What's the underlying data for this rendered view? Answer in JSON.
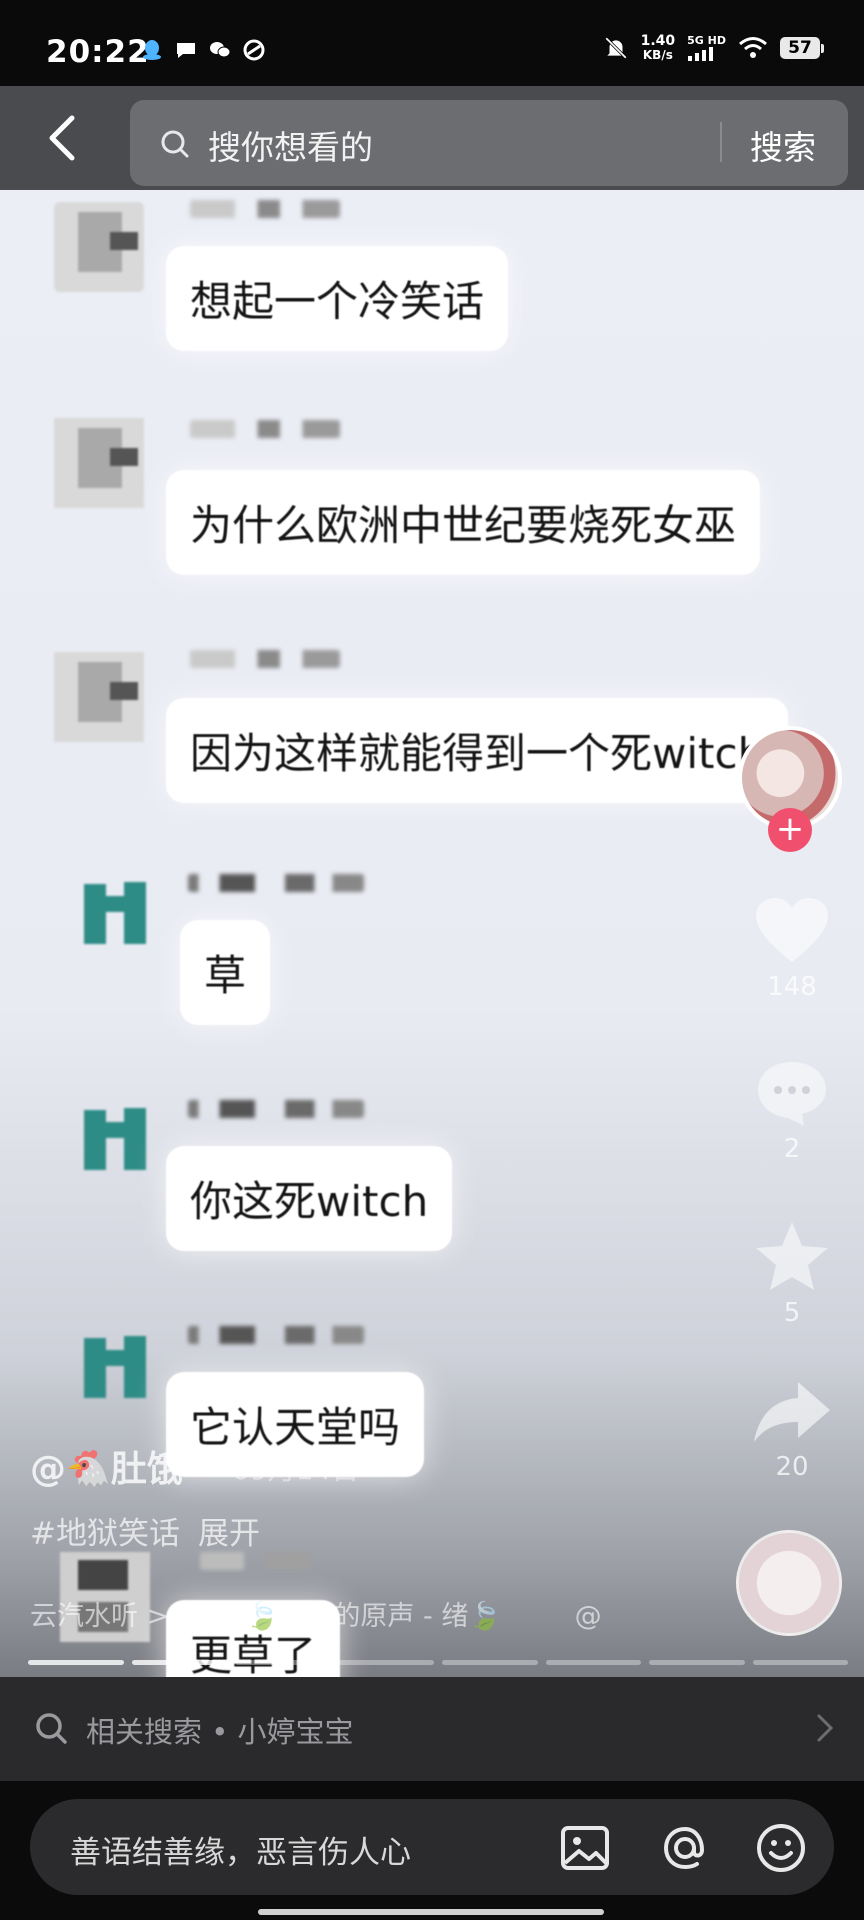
{
  "status_bar": {
    "time": "20:22",
    "net_speed_value": "1.40",
    "net_speed_unit": "KB/s",
    "net_type": "5G HD",
    "battery": "57"
  },
  "search": {
    "placeholder": "搜你想看的",
    "submit_label": "搜索"
  },
  "chat": {
    "messages": [
      {
        "text": "想起一个冷笑话"
      },
      {
        "text": "为什么欧洲中世纪要烧死女巫"
      },
      {
        "text": "因为这样就能得到一个死witch"
      },
      {
        "text": "草"
      },
      {
        "text": "你这死witch"
      },
      {
        "text": "它认天堂吗"
      },
      {
        "text": "更草了"
      }
    ]
  },
  "actions": {
    "likes": "148",
    "comments": "2",
    "favorites": "5",
    "shares": "20"
  },
  "video_info": {
    "author": "@🐔肚饿",
    "date": "09月14日",
    "tags": "#地狱笑话",
    "expand_label": "展开",
    "music_prefix": "云汽水听 >",
    "music": "@绪🍃创作的原声 - 绪🍃",
    "music_suffix": "@"
  },
  "related_search": {
    "text": "相关搜索 • 小婷宝宝"
  },
  "comment": {
    "placeholder": "善语结善缘，恶言伤人心"
  },
  "colors": {
    "header_bg": "#4a4b4f",
    "follow_accent": "#f0506e"
  }
}
